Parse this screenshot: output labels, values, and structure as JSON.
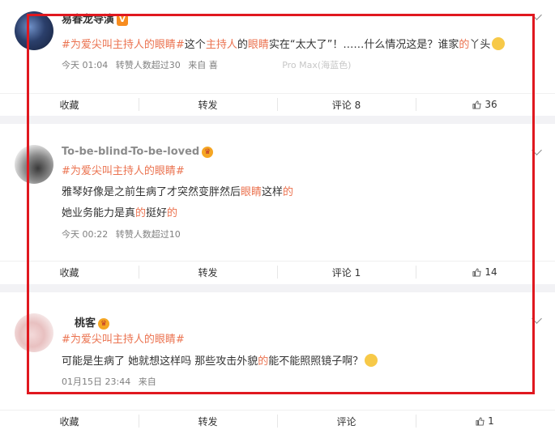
{
  "posts": [
    {
      "username": "易春龙导演",
      "topic": "#为爱尖叫主持人的眼睛#",
      "lines": [
        {
          "segments": [
            {
              "text": "这个",
              "hl": false
            },
            {
              "text": "主持人",
              "hl": true
            },
            {
              "text": "的",
              "hl": false
            },
            {
              "text": "眼睛",
              "hl": true
            },
            {
              "text": "实在“太大了”！……什么情况这是？谁家",
              "hl": false
            },
            {
              "text": "的",
              "hl": true
            },
            {
              "text": "丫头",
              "hl": false
            }
          ]
        }
      ],
      "time": "今天 01:04",
      "reposts": "转赞人数超过30",
      "source": "来自 喜",
      "device": "Pro Max(海蓝色)",
      "actions": {
        "fav": "收藏",
        "repost": "转发",
        "comment": "评论 8",
        "like": "36"
      }
    },
    {
      "username": "To-be-blind-To-be-loved",
      "topic": "#为爱尖叫主持人的眼睛#",
      "lines": [
        {
          "segments": [
            {
              "text": "雅琴好像是之前生病了才突然变胖然后",
              "hl": false
            },
            {
              "text": "眼睛",
              "hl": true
            },
            {
              "text": "这样",
              "hl": false
            },
            {
              "text": "的",
              "hl": true
            }
          ]
        },
        {
          "segments": [
            {
              "text": "她业务能力是真",
              "hl": false
            },
            {
              "text": "的",
              "hl": true
            },
            {
              "text": "挺好",
              "hl": false
            },
            {
              "text": "的",
              "hl": true
            }
          ]
        }
      ],
      "time": "今天 00:22",
      "reposts": "转赞人数超过10",
      "actions": {
        "fav": "收藏",
        "repost": "转发",
        "comment": "评论 1",
        "like": "14"
      }
    },
    {
      "username": "桃客",
      "topic": "#为爱尖叫主持人的眼睛#",
      "lines": [
        {
          "segments": [
            {
              "text": "可能是生病了 她就想这样吗 那些攻击外貌",
              "hl": false
            },
            {
              "text": "的",
              "hl": true
            },
            {
              "text": "能不能照照镜子啊？",
              "hl": false
            }
          ]
        }
      ],
      "time": "01月15日 23:44",
      "source": "来自",
      "actions": {
        "fav": "收藏",
        "repost": "转发",
        "comment": "评论",
        "like": "1"
      }
    }
  ],
  "colors": {
    "highlight": "#eb7350",
    "frame": "#e0181f",
    "topic": "#eb7350"
  },
  "icons": {
    "verified": "V-badge",
    "vip": "crown-icon",
    "like": "thumb-up-icon",
    "more": "chevron-down-icon"
  }
}
